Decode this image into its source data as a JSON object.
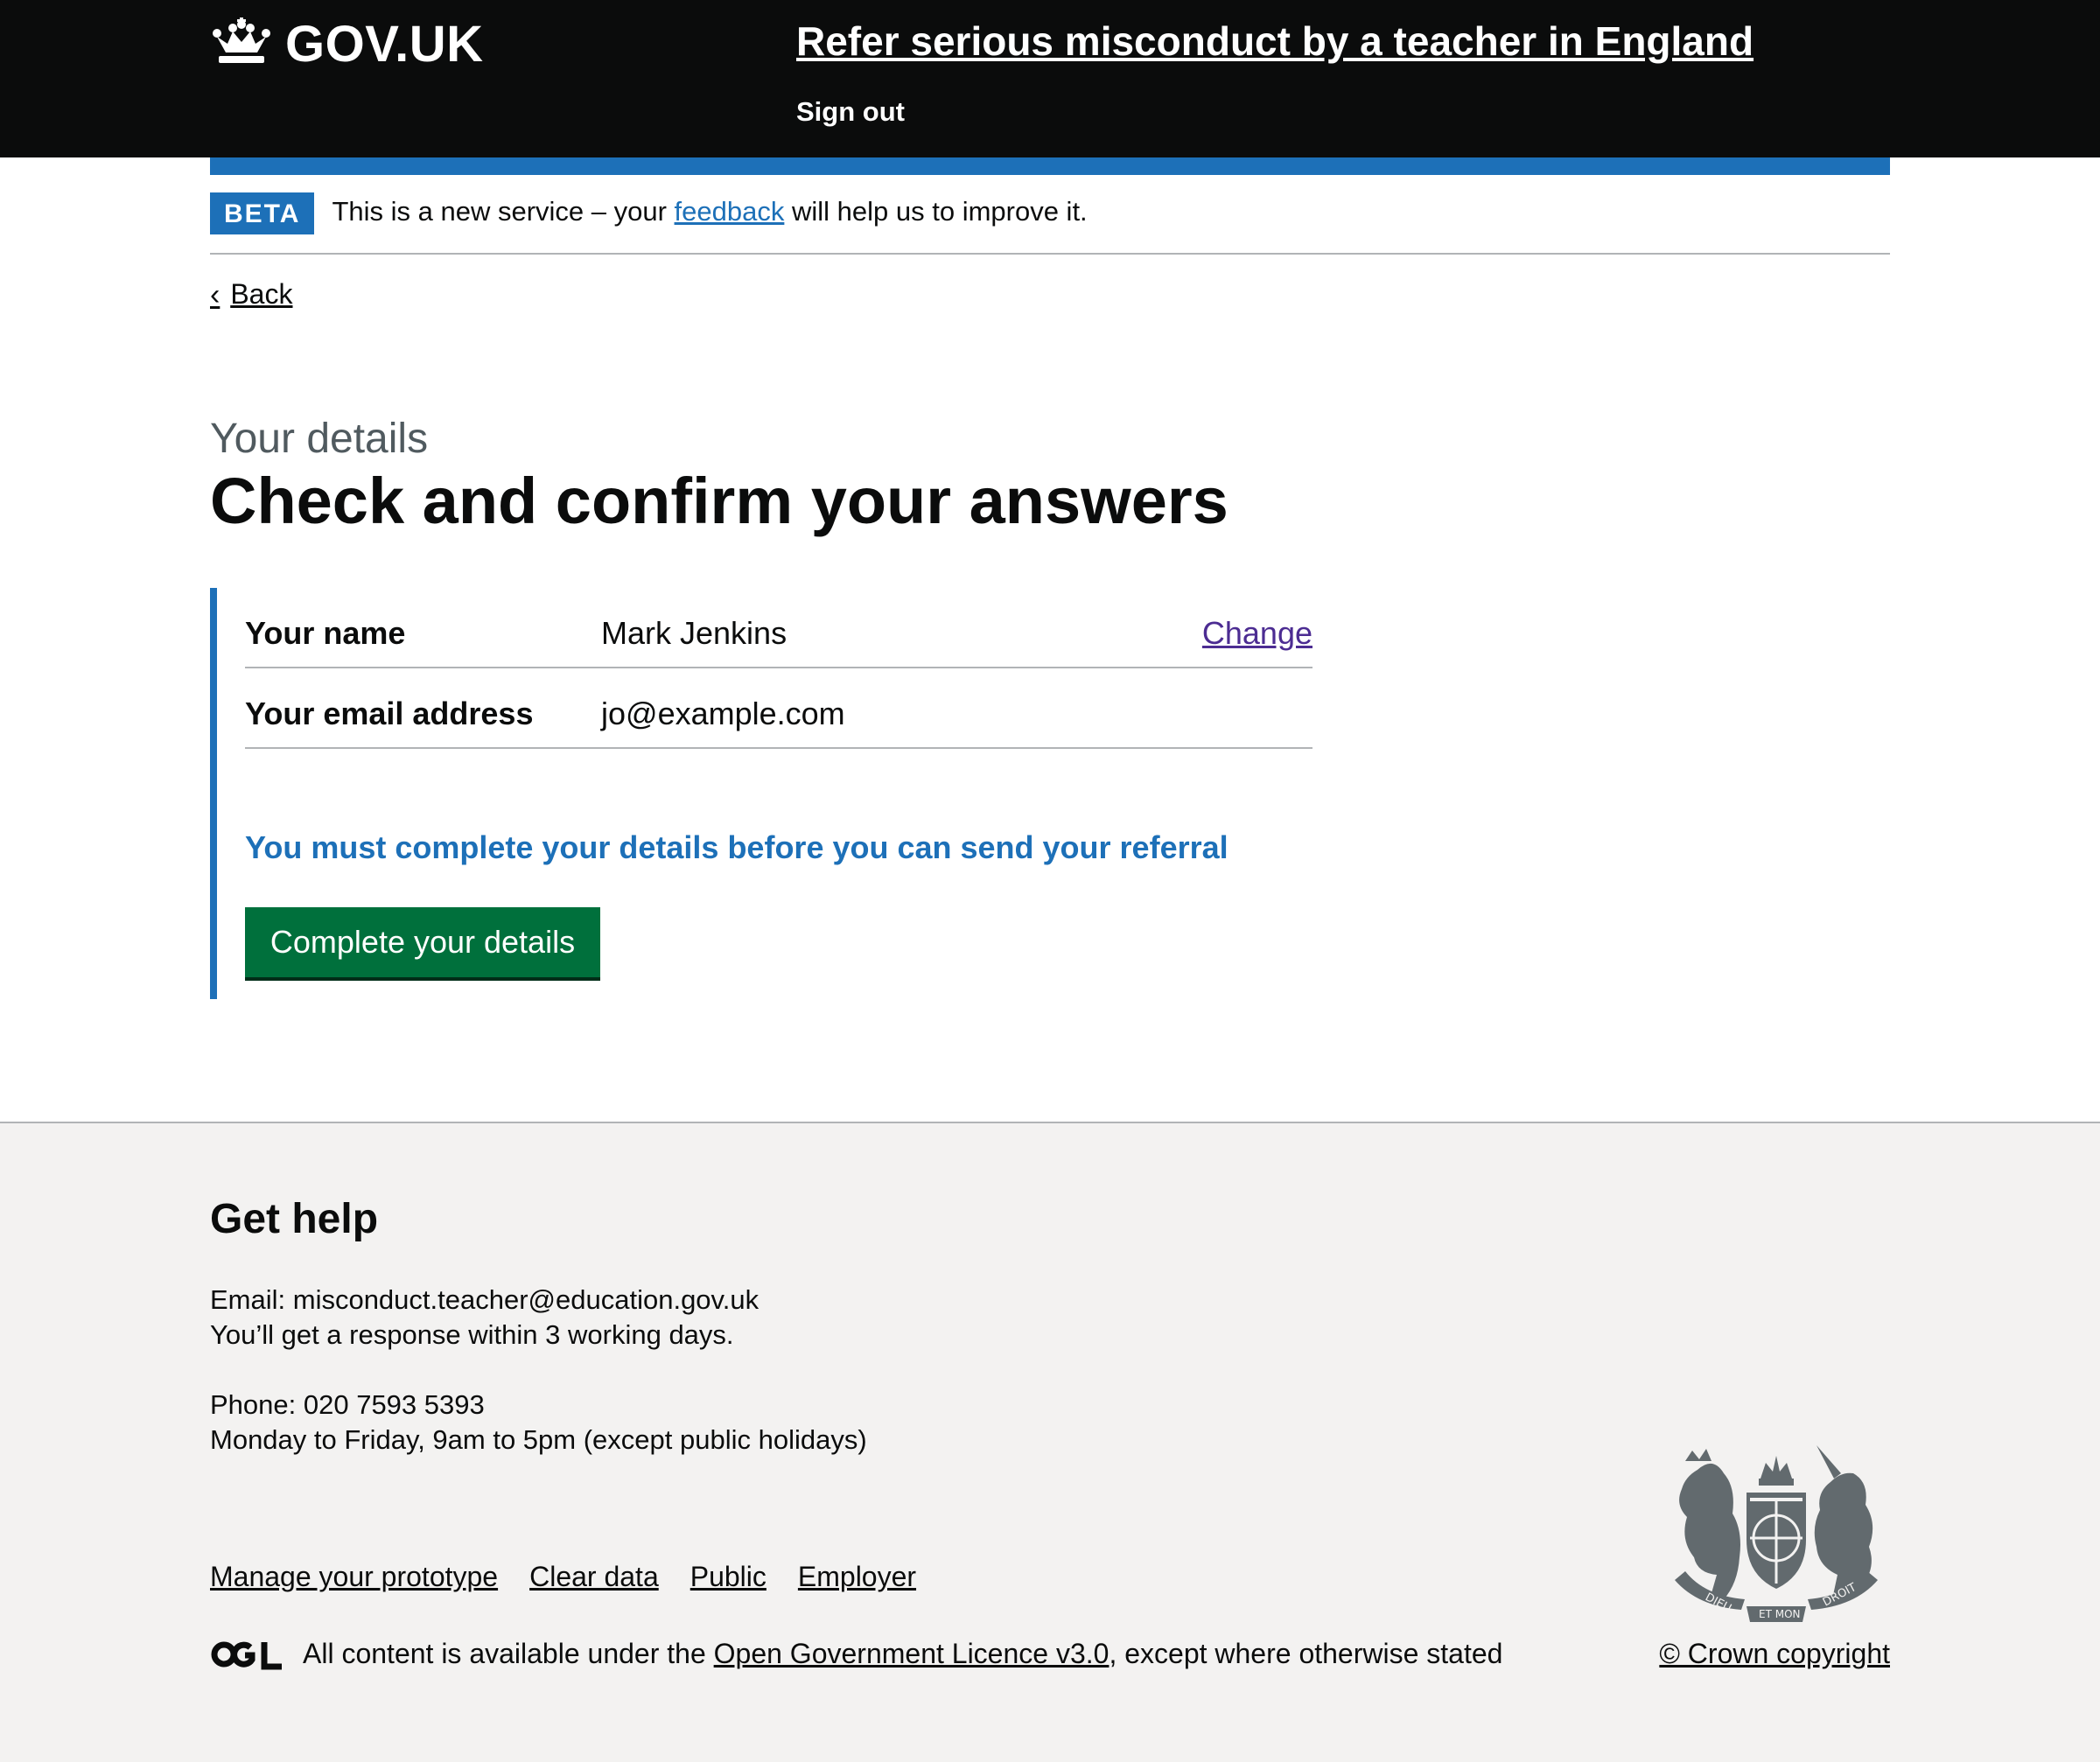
{
  "header": {
    "logo_text": "GOV.UK",
    "service_name": "Refer serious misconduct by a teacher in England",
    "sign_out": "Sign out"
  },
  "phase_banner": {
    "tag": "BETA",
    "text_before": "This is a new service – your ",
    "link": "feedback",
    "text_after": " will help us to improve it."
  },
  "back_link": "Back",
  "page": {
    "caption": "Your details",
    "title": "Check and confirm your answers"
  },
  "summary": {
    "rows": [
      {
        "key": "Your name",
        "value": "Mark Jenkins",
        "action": "Change"
      },
      {
        "key": "Your email address",
        "value": "jo@example.com",
        "action": ""
      }
    ],
    "warning": "You must complete your details before you can send your referral",
    "button": "Complete your details"
  },
  "footer": {
    "help_title": "Get help",
    "email_line": "Email: misconduct.teacher@education.gov.uk",
    "email_response": "You’ll get a response within 3 working days.",
    "phone_line": "Phone: 020 7593 5393",
    "phone_hours": "Monday to Friday, 9am to 5pm (except public holidays)",
    "links": [
      "Manage your prototype",
      "Clear data",
      "Public",
      "Employer"
    ],
    "licence_before": "All content is available under the ",
    "licence_link": "Open Government Licence v3.0",
    "licence_after": ", except where otherwise stated",
    "copyright": "© Crown copyright",
    "crest_motto_left": "DIEU",
    "crest_motto_middle": "ET MON",
    "crest_motto_right": "DROIT"
  },
  "colors": {
    "header_bg": "#0b0c0c",
    "brand_blue": "#1d70b8",
    "button_green": "#00703c",
    "visited_link": "#4c2c92",
    "footer_bg": "#f3f2f1"
  }
}
